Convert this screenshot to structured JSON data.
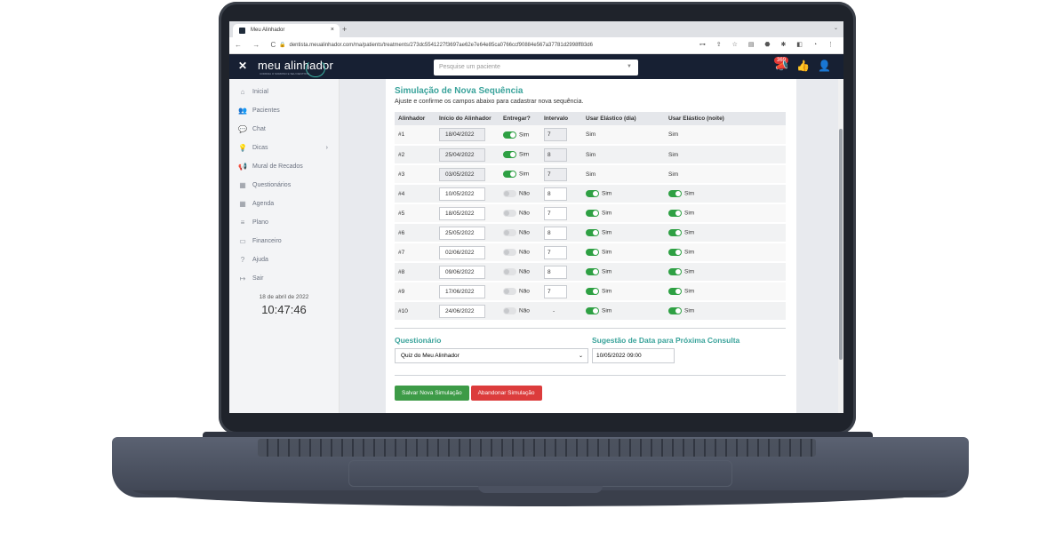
{
  "browser": {
    "tab_title": "Meu Alinhador",
    "tab_close": "×",
    "new_tab": "+",
    "tab_menu": "⌄",
    "nav": "← → C",
    "url": "dentista.meualinhador.com/ma/patients/treatments/273dc5541227f3697ae62e7e64e85ca0766ccf90884e567a37781d2998ff83d6",
    "ext_icons": "⊶ ⇪ ☆ ▤ ⬣ ✱ ◧ ◔ ⋮"
  },
  "header": {
    "logo": "meu alinhador",
    "logo_sub": "CORRIJA O SORRISO E SEU DENTISTA",
    "search_placeholder": "Pesquise um paciente",
    "notification_count": "369"
  },
  "sidebar": {
    "items": [
      {
        "label": "Inicial",
        "icon": "⌂"
      },
      {
        "label": "Pacientes",
        "icon": "👥"
      },
      {
        "label": "Chat",
        "icon": "💬"
      },
      {
        "label": "Dicas",
        "icon": "💡"
      },
      {
        "label": "Mural de Recados",
        "icon": "📢"
      },
      {
        "label": "Questionários",
        "icon": "▦"
      },
      {
        "label": "Agenda",
        "icon": "▦"
      },
      {
        "label": "Plano",
        "icon": "≡"
      },
      {
        "label": "Financeiro",
        "icon": "▭"
      },
      {
        "label": "Ajuda",
        "icon": "?"
      },
      {
        "label": "Sair",
        "icon": "↦"
      }
    ],
    "date": "18 de abril de 2022",
    "time": "10:47:46"
  },
  "main": {
    "title": "Simulação de Nova Sequência",
    "subtitle": "Ajuste e confirme os campos abaixo para cadastrar nova sequência.",
    "columns": [
      "Alinhador",
      "Início do Alinhador",
      "Entregar?",
      "Intervalo",
      "Usar Elástico (dia)",
      "Usar Elástico (noite)"
    ],
    "rows": [
      {
        "n": "#1",
        "date": "18/04/2022",
        "deliver": "Sim",
        "interval": "7",
        "day": "Sim",
        "night": "Sim"
      },
      {
        "n": "#2",
        "date": "25/04/2022",
        "deliver": "Sim",
        "interval": "8",
        "day": "Sim",
        "night": "Sim"
      },
      {
        "n": "#3",
        "date": "03/05/2022",
        "deliver": "Sim",
        "interval": "7",
        "day": "Sim",
        "night": "Sim"
      },
      {
        "n": "#4",
        "date": "10/05/2022",
        "deliver": "Não",
        "interval": "8",
        "day": "Sim",
        "night": "Sim"
      },
      {
        "n": "#5",
        "date": "18/05/2022",
        "deliver": "Não",
        "interval": "7",
        "day": "Sim",
        "night": "Sim"
      },
      {
        "n": "#6",
        "date": "25/05/2022",
        "deliver": "Não",
        "interval": "8",
        "day": "Sim",
        "night": "Sim"
      },
      {
        "n": "#7",
        "date": "02/06/2022",
        "deliver": "Não",
        "interval": "7",
        "day": "Sim",
        "night": "Sim"
      },
      {
        "n": "#8",
        "date": "09/06/2022",
        "deliver": "Não",
        "interval": "8",
        "day": "Sim",
        "night": "Sim"
      },
      {
        "n": "#9",
        "date": "17/06/2022",
        "deliver": "Não",
        "interval": "7",
        "day": "Sim",
        "night": "Sim"
      },
      {
        "n": "#10",
        "date": "24/06/2022",
        "deliver": "Não",
        "interval": "-",
        "day": "Sim",
        "night": "Sim"
      }
    ],
    "questionario_label": "Questionário",
    "questionario_value": "Quiz do Meu Alinhador",
    "suggest_label": "Sugestão de Data para Próxima Consulta",
    "suggest_value": "10/05/2022 09:00",
    "save_label": "Salvar Nova Simulação",
    "abandon_label": "Abandonar Simulação"
  },
  "colors": {
    "accent": "#3aa39b",
    "header_bg": "#172033",
    "toggle_on": "#2ea043",
    "save": "#3d9b47",
    "abandon": "#dc3c3c"
  }
}
